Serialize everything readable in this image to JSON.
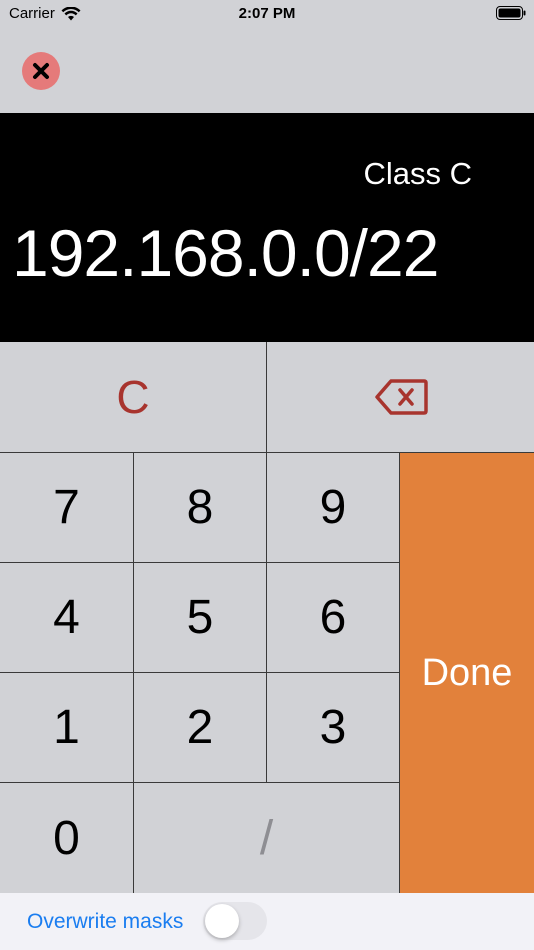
{
  "status_bar": {
    "carrier": "Carrier",
    "time": "2:07 PM",
    "icons": [
      "wifi-icon",
      "battery-icon"
    ]
  },
  "top_bar": {
    "close_icon": "close-icon"
  },
  "display": {
    "class_label": "Class C",
    "value": "192.168.0.0/22"
  },
  "keypad": {
    "clear": "C",
    "backspace_icon": "backspace-icon",
    "digits": {
      "seven": "7",
      "eight": "8",
      "nine": "9",
      "four": "4",
      "five": "5",
      "six": "6",
      "one": "1",
      "two": "2",
      "three": "3",
      "zero": "0"
    },
    "slash": "/",
    "done": "Done"
  },
  "bottom_bar": {
    "overwrite_label": "Overwrite masks",
    "overwrite_enabled": false
  },
  "colors": {
    "background": "#d1d2d6",
    "display_bg": "#000000",
    "clear_red": "#a8342e",
    "close_button": "#e57a7a",
    "done_orange": "#e2813b",
    "link_blue": "#1a7df0"
  }
}
